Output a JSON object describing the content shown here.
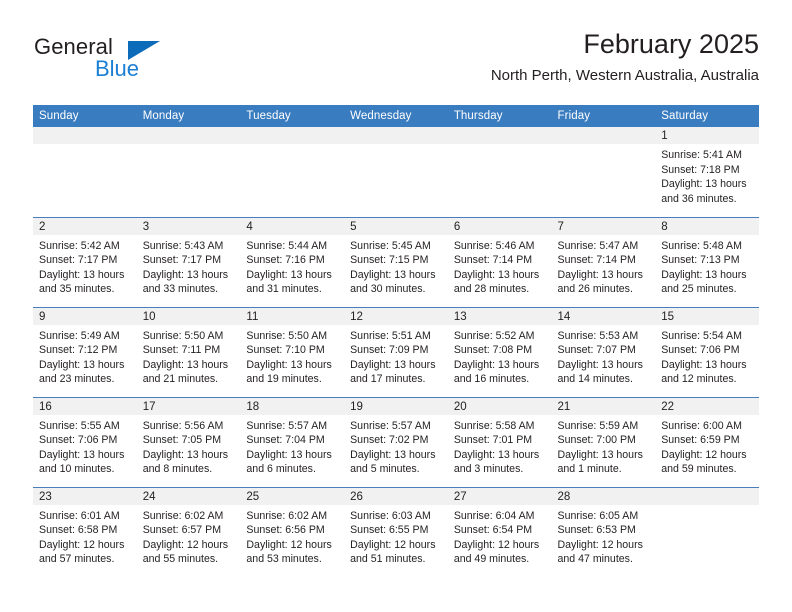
{
  "brand": {
    "name_top": "General",
    "name_bottom": "Blue",
    "accent_color": "#1b7fd4",
    "triangle_color": "#0d6cb9"
  },
  "header": {
    "title": "February 2025",
    "subtitle": "North Perth, Western Australia, Australia",
    "header_bg_color": "#3a7cc0",
    "daynum_bg_color": "#f1f1f1"
  },
  "weekday_headers": [
    "Sunday",
    "Monday",
    "Tuesday",
    "Wednesday",
    "Thursday",
    "Friday",
    "Saturday"
  ],
  "weeks": [
    [
      {
        "day": "",
        "sunrise": "",
        "sunset": "",
        "daylight_line1": "",
        "daylight_line2": "",
        "empty": true
      },
      {
        "day": "",
        "sunrise": "",
        "sunset": "",
        "daylight_line1": "",
        "daylight_line2": "",
        "empty": true
      },
      {
        "day": "",
        "sunrise": "",
        "sunset": "",
        "daylight_line1": "",
        "daylight_line2": "",
        "empty": true
      },
      {
        "day": "",
        "sunrise": "",
        "sunset": "",
        "daylight_line1": "",
        "daylight_line2": "",
        "empty": true
      },
      {
        "day": "",
        "sunrise": "",
        "sunset": "",
        "daylight_line1": "",
        "daylight_line2": "",
        "empty": true
      },
      {
        "day": "",
        "sunrise": "",
        "sunset": "",
        "daylight_line1": "",
        "daylight_line2": "",
        "empty": true
      },
      {
        "day": "1",
        "sunrise": "Sunrise: 5:41 AM",
        "sunset": "Sunset: 7:18 PM",
        "daylight_line1": "Daylight: 13 hours",
        "daylight_line2": "and 36 minutes.",
        "empty": false
      }
    ],
    [
      {
        "day": "2",
        "sunrise": "Sunrise: 5:42 AM",
        "sunset": "Sunset: 7:17 PM",
        "daylight_line1": "Daylight: 13 hours",
        "daylight_line2": "and 35 minutes.",
        "empty": false
      },
      {
        "day": "3",
        "sunrise": "Sunrise: 5:43 AM",
        "sunset": "Sunset: 7:17 PM",
        "daylight_line1": "Daylight: 13 hours",
        "daylight_line2": "and 33 minutes.",
        "empty": false
      },
      {
        "day": "4",
        "sunrise": "Sunrise: 5:44 AM",
        "sunset": "Sunset: 7:16 PM",
        "daylight_line1": "Daylight: 13 hours",
        "daylight_line2": "and 31 minutes.",
        "empty": false
      },
      {
        "day": "5",
        "sunrise": "Sunrise: 5:45 AM",
        "sunset": "Sunset: 7:15 PM",
        "daylight_line1": "Daylight: 13 hours",
        "daylight_line2": "and 30 minutes.",
        "empty": false
      },
      {
        "day": "6",
        "sunrise": "Sunrise: 5:46 AM",
        "sunset": "Sunset: 7:14 PM",
        "daylight_line1": "Daylight: 13 hours",
        "daylight_line2": "and 28 minutes.",
        "empty": false
      },
      {
        "day": "7",
        "sunrise": "Sunrise: 5:47 AM",
        "sunset": "Sunset: 7:14 PM",
        "daylight_line1": "Daylight: 13 hours",
        "daylight_line2": "and 26 minutes.",
        "empty": false
      },
      {
        "day": "8",
        "sunrise": "Sunrise: 5:48 AM",
        "sunset": "Sunset: 7:13 PM",
        "daylight_line1": "Daylight: 13 hours",
        "daylight_line2": "and 25 minutes.",
        "empty": false
      }
    ],
    [
      {
        "day": "9",
        "sunrise": "Sunrise: 5:49 AM",
        "sunset": "Sunset: 7:12 PM",
        "daylight_line1": "Daylight: 13 hours",
        "daylight_line2": "and 23 minutes.",
        "empty": false
      },
      {
        "day": "10",
        "sunrise": "Sunrise: 5:50 AM",
        "sunset": "Sunset: 7:11 PM",
        "daylight_line1": "Daylight: 13 hours",
        "daylight_line2": "and 21 minutes.",
        "empty": false
      },
      {
        "day": "11",
        "sunrise": "Sunrise: 5:50 AM",
        "sunset": "Sunset: 7:10 PM",
        "daylight_line1": "Daylight: 13 hours",
        "daylight_line2": "and 19 minutes.",
        "empty": false
      },
      {
        "day": "12",
        "sunrise": "Sunrise: 5:51 AM",
        "sunset": "Sunset: 7:09 PM",
        "daylight_line1": "Daylight: 13 hours",
        "daylight_line2": "and 17 minutes.",
        "empty": false
      },
      {
        "day": "13",
        "sunrise": "Sunrise: 5:52 AM",
        "sunset": "Sunset: 7:08 PM",
        "daylight_line1": "Daylight: 13 hours",
        "daylight_line2": "and 16 minutes.",
        "empty": false
      },
      {
        "day": "14",
        "sunrise": "Sunrise: 5:53 AM",
        "sunset": "Sunset: 7:07 PM",
        "daylight_line1": "Daylight: 13 hours",
        "daylight_line2": "and 14 minutes.",
        "empty": false
      },
      {
        "day": "15",
        "sunrise": "Sunrise: 5:54 AM",
        "sunset": "Sunset: 7:06 PM",
        "daylight_line1": "Daylight: 13 hours",
        "daylight_line2": "and 12 minutes.",
        "empty": false
      }
    ],
    [
      {
        "day": "16",
        "sunrise": "Sunrise: 5:55 AM",
        "sunset": "Sunset: 7:06 PM",
        "daylight_line1": "Daylight: 13 hours",
        "daylight_line2": "and 10 minutes.",
        "empty": false
      },
      {
        "day": "17",
        "sunrise": "Sunrise: 5:56 AM",
        "sunset": "Sunset: 7:05 PM",
        "daylight_line1": "Daylight: 13 hours",
        "daylight_line2": "and 8 minutes.",
        "empty": false
      },
      {
        "day": "18",
        "sunrise": "Sunrise: 5:57 AM",
        "sunset": "Sunset: 7:04 PM",
        "daylight_line1": "Daylight: 13 hours",
        "daylight_line2": "and 6 minutes.",
        "empty": false
      },
      {
        "day": "19",
        "sunrise": "Sunrise: 5:57 AM",
        "sunset": "Sunset: 7:02 PM",
        "daylight_line1": "Daylight: 13 hours",
        "daylight_line2": "and 5 minutes.",
        "empty": false
      },
      {
        "day": "20",
        "sunrise": "Sunrise: 5:58 AM",
        "sunset": "Sunset: 7:01 PM",
        "daylight_line1": "Daylight: 13 hours",
        "daylight_line2": "and 3 minutes.",
        "empty": false
      },
      {
        "day": "21",
        "sunrise": "Sunrise: 5:59 AM",
        "sunset": "Sunset: 7:00 PM",
        "daylight_line1": "Daylight: 13 hours",
        "daylight_line2": "and 1 minute.",
        "empty": false
      },
      {
        "day": "22",
        "sunrise": "Sunrise: 6:00 AM",
        "sunset": "Sunset: 6:59 PM",
        "daylight_line1": "Daylight: 12 hours",
        "daylight_line2": "and 59 minutes.",
        "empty": false
      }
    ],
    [
      {
        "day": "23",
        "sunrise": "Sunrise: 6:01 AM",
        "sunset": "Sunset: 6:58 PM",
        "daylight_line1": "Daylight: 12 hours",
        "daylight_line2": "and 57 minutes.",
        "empty": false
      },
      {
        "day": "24",
        "sunrise": "Sunrise: 6:02 AM",
        "sunset": "Sunset: 6:57 PM",
        "daylight_line1": "Daylight: 12 hours",
        "daylight_line2": "and 55 minutes.",
        "empty": false
      },
      {
        "day": "25",
        "sunrise": "Sunrise: 6:02 AM",
        "sunset": "Sunset: 6:56 PM",
        "daylight_line1": "Daylight: 12 hours",
        "daylight_line2": "and 53 minutes.",
        "empty": false
      },
      {
        "day": "26",
        "sunrise": "Sunrise: 6:03 AM",
        "sunset": "Sunset: 6:55 PM",
        "daylight_line1": "Daylight: 12 hours",
        "daylight_line2": "and 51 minutes.",
        "empty": false
      },
      {
        "day": "27",
        "sunrise": "Sunrise: 6:04 AM",
        "sunset": "Sunset: 6:54 PM",
        "daylight_line1": "Daylight: 12 hours",
        "daylight_line2": "and 49 minutes.",
        "empty": false
      },
      {
        "day": "28",
        "sunrise": "Sunrise: 6:05 AM",
        "sunset": "Sunset: 6:53 PM",
        "daylight_line1": "Daylight: 12 hours",
        "daylight_line2": "and 47 minutes.",
        "empty": false
      },
      {
        "day": "",
        "sunrise": "",
        "sunset": "",
        "daylight_line1": "",
        "daylight_line2": "",
        "empty": true
      }
    ]
  ]
}
